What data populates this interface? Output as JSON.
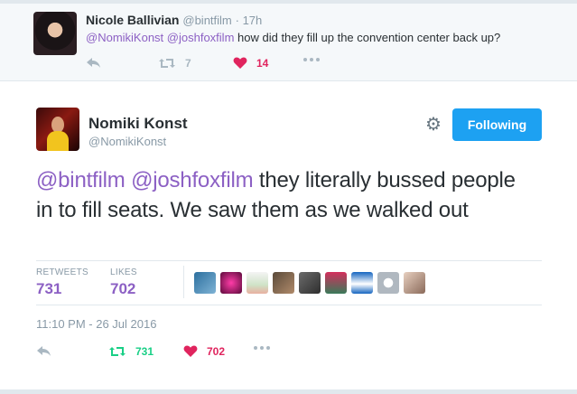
{
  "reply_tweet": {
    "author_name": "Nicole Ballivian",
    "author_handle": "@bintfilm",
    "time": "· 17h",
    "mention_1": "@NomikiKonst",
    "mention_2": "@joshfoxfilm",
    "text": " how did they fill up the convention center back up?",
    "retweets": "7",
    "likes": "14"
  },
  "main_tweet": {
    "author_name": "Nomiki Konst",
    "author_handle": "@NomikiKonst",
    "follow_label": "Following",
    "mention_1": "@bintfilm",
    "mention_2": "@joshfoxfilm",
    "text": " they literally bussed people in to fill seats. We saw them as we walked out",
    "retweets_label": "RETWEETS",
    "retweets_count": "731",
    "likes_label": "LIKES",
    "likes_count": "702",
    "timestamp": "11:10 PM - 26 Jul 2016",
    "action_retweets": "731",
    "action_likes": "702"
  },
  "icons": {
    "reply": "reply-icon",
    "retweet": "retweet-icon",
    "like": "heart-icon",
    "more": "more-icon",
    "gear": "gear-icon"
  },
  "colors": {
    "accent": "#1da1f2",
    "mention": "#8c60c4",
    "like": "#e0245e",
    "retweet": "#19cf86"
  }
}
